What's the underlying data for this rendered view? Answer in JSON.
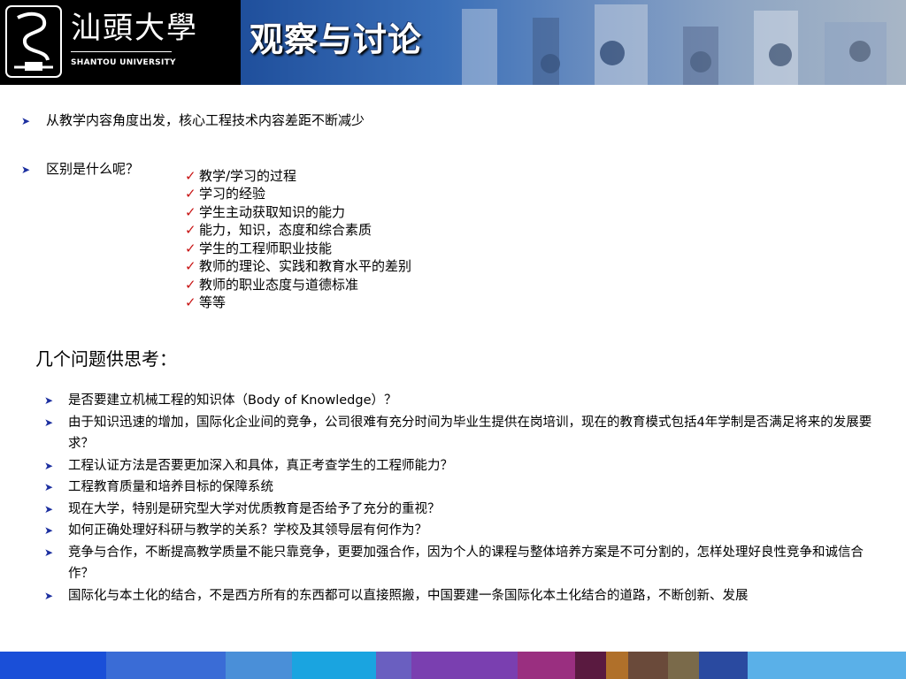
{
  "header": {
    "university_cn": "汕頭大學",
    "university_en": "SHANTOU UNIVERSITY",
    "slide_title": "观察与讨论"
  },
  "bullets": [
    "从教学内容角度出发，核心工程技术内容差距不断减少",
    "区别是什么呢？"
  ],
  "checklist": [
    "教学/学习的过程",
    "学习的经验",
    "学生主动获取知识的能力",
    "能力，知识，态度和综合素质",
    "学生的工程师职业技能",
    "教师的理论、实践和教育水平的差别",
    "教师的职业态度与道德标准",
    "等等"
  ],
  "questions_title": "几个问题供思考：",
  "questions": [
    "是否要建立机械工程的知识体（Body of Knowledge）？",
    "由于知识迅速的增加，国际化企业间的竞争，公司很难有充分时间为毕业生提供在岗培训，现在的教育模式包括4年学制是否满足将来的发展要求？",
    "工程认证方法是否要更加深入和具体，真正考查学生的工程师能力？",
    "工程教育质量和培养目标的保障系统",
    "现在大学，特别是研究型大学对优质教育是否给予了充分的重视？",
    "如何正确处理好科研与教学的关系？学校及其领导层有何作为？",
    "竞争与合作，不断提高教学质量不能只靠竞争，更要加强合作，因为个人的课程与整体培养方案是不可分割的，怎样处理好良性竞争和诚信合作？",
    "国际化与本土化的结合，不是西方所有的东西都可以直接照搬，中国要建一条国际化本土化结合的道路，不断创新、发展"
  ],
  "icons": {
    "bullet": "arrow-bullet-icon",
    "check": "checkmark-icon"
  },
  "colors": {
    "header_bg": "#000000",
    "title_text": "#ffffff",
    "bullet_arrow": "#1c2fa0",
    "checkmark": "#c81414",
    "footer": [
      "#1a4fd8",
      "#3a6cd6",
      "#4a8fd8",
      "#1aa4e0",
      "#6a5fc0",
      "#7a3fb0",
      "#9a2f80",
      "#5a1a40",
      "#b0702a",
      "#6a4a3a",
      "#7a6a4a",
      "#2a4aa0",
      "#5ab0e8"
    ]
  }
}
